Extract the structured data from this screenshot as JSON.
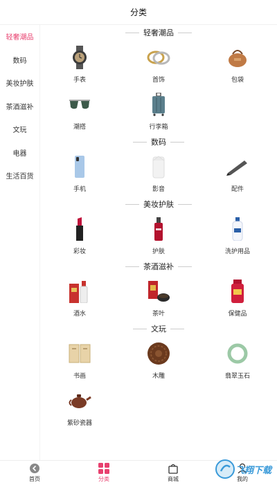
{
  "header": {
    "title": "分类"
  },
  "sidebar": {
    "items": [
      {
        "label": "轻奢潮品",
        "active": true
      },
      {
        "label": "数码",
        "active": false
      },
      {
        "label": "美妆护肤",
        "active": false
      },
      {
        "label": "茶酒滋补",
        "active": false
      },
      {
        "label": "文玩",
        "active": false
      },
      {
        "label": "电器",
        "active": false
      },
      {
        "label": "生活百货",
        "active": false
      }
    ]
  },
  "sections": [
    {
      "title": "轻奢潮品",
      "items": [
        {
          "label": "手表",
          "icon": "watch-icon"
        },
        {
          "label": "首饰",
          "icon": "ring-icon"
        },
        {
          "label": "包袋",
          "icon": "handbag-icon"
        },
        {
          "label": "潮搭",
          "icon": "sunglasses-icon"
        },
        {
          "label": "行李箱",
          "icon": "suitcase-icon"
        }
      ]
    },
    {
      "title": "数码",
      "items": [
        {
          "label": "手机",
          "icon": "phone-icon"
        },
        {
          "label": "影音",
          "icon": "speaker-icon"
        },
        {
          "label": "配件",
          "icon": "pen-accessory-icon"
        }
      ]
    },
    {
      "title": "美妆护肤",
      "items": [
        {
          "label": "彩妆",
          "icon": "lipstick-icon"
        },
        {
          "label": "护肤",
          "icon": "skincare-bottle-icon"
        },
        {
          "label": "洗护用品",
          "icon": "shampoo-icon"
        }
      ]
    },
    {
      "title": "茶酒滋补",
      "items": [
        {
          "label": "酒水",
          "icon": "liquor-icon"
        },
        {
          "label": "茶叶",
          "icon": "tea-icon"
        },
        {
          "label": "保健品",
          "icon": "supplement-jar-icon"
        }
      ]
    },
    {
      "title": "文玩",
      "items": [
        {
          "label": "书画",
          "icon": "scroll-icon"
        },
        {
          "label": "木雕",
          "icon": "wood-carving-icon"
        },
        {
          "label": "翡翠玉石",
          "icon": "jade-bangle-icon"
        },
        {
          "label": "紫砂瓷器",
          "icon": "teapot-icon"
        }
      ]
    }
  ],
  "tabbar": {
    "items": [
      {
        "label": "首页",
        "icon": "home-icon",
        "active": false
      },
      {
        "label": "分类",
        "icon": "category-grid-icon",
        "active": true
      },
      {
        "label": "商城",
        "icon": "shopping-bag-icon",
        "active": false
      },
      {
        "label": "我的",
        "icon": "profile-icon",
        "active": false
      }
    ]
  },
  "watermark": {
    "text": "飞翔下载"
  },
  "colors": {
    "accent": "#e8416f",
    "text": "#333333",
    "divider": "#cccccc"
  }
}
